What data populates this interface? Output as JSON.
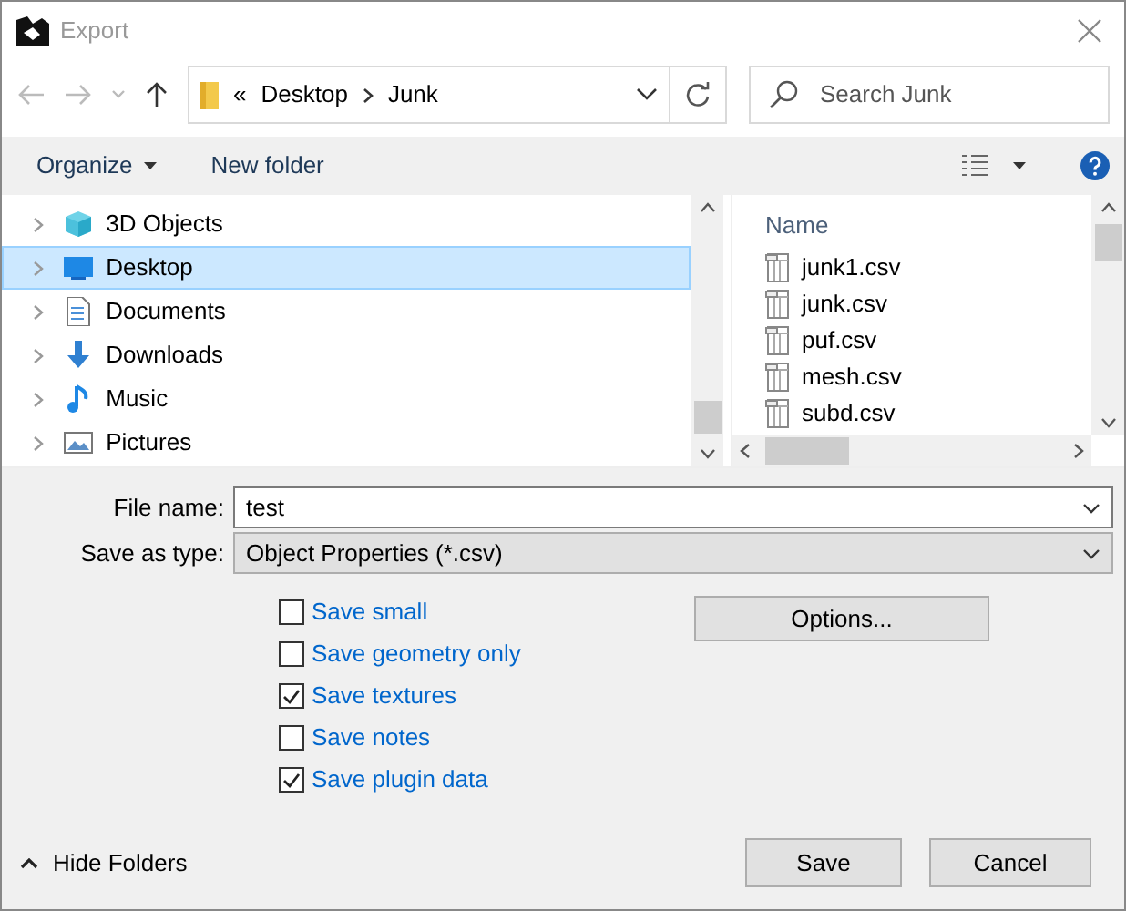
{
  "window": {
    "title": "Export"
  },
  "address_bar": {
    "overflow": "«",
    "path": [
      "Desktop",
      "Junk"
    ]
  },
  "search": {
    "placeholder": "Search Junk"
  },
  "toolbar": {
    "organize": "Organize",
    "new_folder": "New folder"
  },
  "folders": [
    {
      "label": "3D Objects",
      "kind": "cube",
      "selected": false
    },
    {
      "label": "Desktop",
      "kind": "desktop",
      "selected": true
    },
    {
      "label": "Documents",
      "kind": "documents",
      "selected": false
    },
    {
      "label": "Downloads",
      "kind": "downloads",
      "selected": false
    },
    {
      "label": "Music",
      "kind": "music",
      "selected": false
    },
    {
      "label": "Pictures",
      "kind": "pictures",
      "selected": false
    }
  ],
  "files": {
    "column": "Name",
    "items": [
      "junk1.csv",
      "junk.csv",
      "puf.csv",
      "mesh.csv",
      "subd.csv"
    ]
  },
  "file_name": {
    "label": "File name:",
    "value": "test"
  },
  "save_type": {
    "label": "Save as type:",
    "value": "Object Properties (*.csv)"
  },
  "options": [
    {
      "label": "Save small",
      "checked": false
    },
    {
      "label": "Save geometry only",
      "checked": false
    },
    {
      "label": "Save textures",
      "checked": true
    },
    {
      "label": "Save notes",
      "checked": false
    },
    {
      "label": "Save plugin data",
      "checked": true
    }
  ],
  "options_button": "Options...",
  "hide_folders": "Hide Folders",
  "buttons": [
    "Save",
    "Cancel"
  ]
}
